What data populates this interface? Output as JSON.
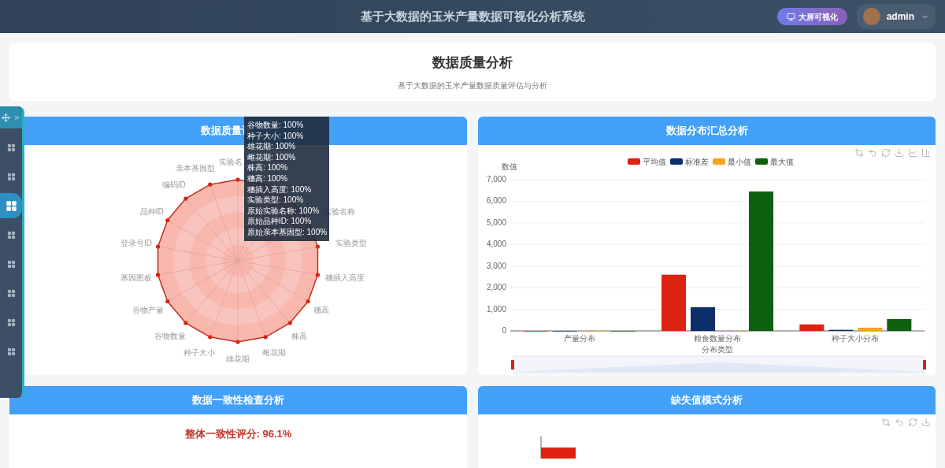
{
  "header": {
    "title": "基于大数据的玉米产量数据可视化分析系统",
    "big_screen_button": "大屏可视化",
    "user": "admin"
  },
  "floating_sidebar": {
    "items": [
      {
        "selected": false
      },
      {
        "selected": false
      },
      {
        "selected": true
      },
      {
        "selected": false
      },
      {
        "selected": false
      },
      {
        "selected": false
      },
      {
        "selected": false
      },
      {
        "selected": false
      }
    ]
  },
  "page_header": {
    "title": "数据质量分析",
    "subtitle": "基于大数据的玉米产量数据质量评估与分析"
  },
  "quality_panel": {
    "title": "数据质量评",
    "radar_labels_left": [
      "实验名",
      "亲本基因型",
      "编码ID",
      "品种ID",
      "登录号ID",
      "基因图板",
      "谷物产量",
      "谷物数量",
      "种子大小",
      "雄花期"
    ],
    "radar_labels_right": [
      "实验名称",
      "实验类型",
      "穗插入高度",
      "穗高",
      "株高",
      "雌花期"
    ],
    "tooltip": [
      "谷物数量: 100%",
      "种子大小: 100%",
      "雄花期: 100%",
      "雌花期: 100%",
      "株高: 100%",
      "穗高: 100%",
      "穗插入高度: 100%",
      "实验类型: 100%",
      "原始实验名称: 100%",
      "原始品种ID: 100%",
      "原始亲本基因型: 100%"
    ]
  },
  "distribution_panel": {
    "title": "数据分布汇总分析",
    "chart_data": {
      "type": "bar",
      "xlabel": "分布类型",
      "ylabel": "数值",
      "categories": [
        "产量分布",
        "粮食数量分布",
        "种子大小分布"
      ],
      "legend": "top",
      "grid": true,
      "series": [
        {
          "name": "平均值",
          "color": "#dd2211",
          "values": [
            0,
            2600,
            300
          ]
        },
        {
          "name": "标准差",
          "color": "#0d2d6b",
          "values": [
            0,
            1100,
            50
          ]
        },
        {
          "name": "最小值",
          "color": "#f5a31a",
          "values": [
            0,
            0,
            150
          ]
        },
        {
          "name": "最大值",
          "color": "#0e5f0e",
          "values": [
            0,
            6450,
            550
          ]
        }
      ],
      "ylim": [
        0,
        7000
      ],
      "yticks": [
        {
          "value": 0,
          "label": "0"
        },
        {
          "value": 1000,
          "label": "1,000"
        },
        {
          "value": 2000,
          "label": "2,000"
        },
        {
          "value": 3000,
          "label": "3,000"
        },
        {
          "value": 4000,
          "label": "4,000"
        },
        {
          "value": 5000,
          "label": "5,000"
        },
        {
          "value": 6000,
          "label": "6,000"
        },
        {
          "value": 7000,
          "label": "7,000"
        }
      ]
    }
  },
  "consistency_panel": {
    "title": "数据一致性检查分析",
    "score": "整体一致性评分: 96.1%"
  },
  "missing_panel": {
    "title": "缺失值模式分析"
  }
}
